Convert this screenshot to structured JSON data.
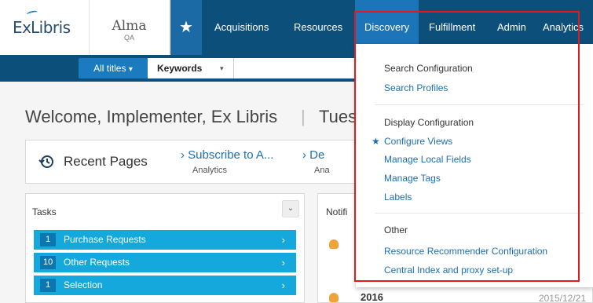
{
  "brand": {
    "logo_ex": "Ex",
    "logo_libris": "Libris",
    "app_title": "Alma",
    "app_env": "QA"
  },
  "nav": {
    "favorites_icon": "star-icon",
    "items": [
      {
        "label": "Acquisitions"
      },
      {
        "label": "Resources"
      },
      {
        "label": "Discovery"
      },
      {
        "label": "Fulfillment"
      },
      {
        "label": "Admin"
      },
      {
        "label": "Analytics"
      }
    ]
  },
  "search": {
    "scope": "All titles",
    "scope_caret": "▾",
    "field": "Keywords",
    "field_caret": "▾",
    "query": ""
  },
  "welcome": {
    "greeting": "Welcome, Implementer, Ex Libris",
    "separator": "|",
    "date_partial": "Tues"
  },
  "recent": {
    "label": "Recent Pages",
    "icon": "history-icon",
    "links": [
      {
        "title": "Subscribe to A...",
        "subtitle": "Analytics"
      },
      {
        "title": "De",
        "subtitle": "Ana"
      }
    ]
  },
  "tasks": {
    "header": "Tasks",
    "collapse_glyph": "⌄",
    "rows": [
      {
        "count": "1",
        "label": "Purchase Requests"
      },
      {
        "count": "10",
        "label": "Other Requests"
      },
      {
        "count": "1",
        "label": "Selection"
      }
    ]
  },
  "notifications": {
    "header": "Notifi",
    "items": [
      {
        "year": "2016",
        "date": "2015/12/21"
      }
    ]
  },
  "discovery_menu": {
    "sections": [
      {
        "heading": "Search Configuration",
        "items": [
          "Search Profiles"
        ]
      },
      {
        "heading": "Display Configuration",
        "items": [
          "Configure Views",
          "Manage Local Fields",
          "Manage Tags",
          "Labels"
        ]
      },
      {
        "heading": "Other",
        "items": [
          "Resource Recommender Configuration",
          "Central Index and proxy set-up"
        ]
      }
    ],
    "favorite_marker": "★"
  },
  "colors": {
    "nav_bg": "#0b4f7a",
    "nav_active": "#1c75b8",
    "task_row": "#15a8dc",
    "link": "#1c6fb5",
    "highlight": "#e3191c"
  }
}
